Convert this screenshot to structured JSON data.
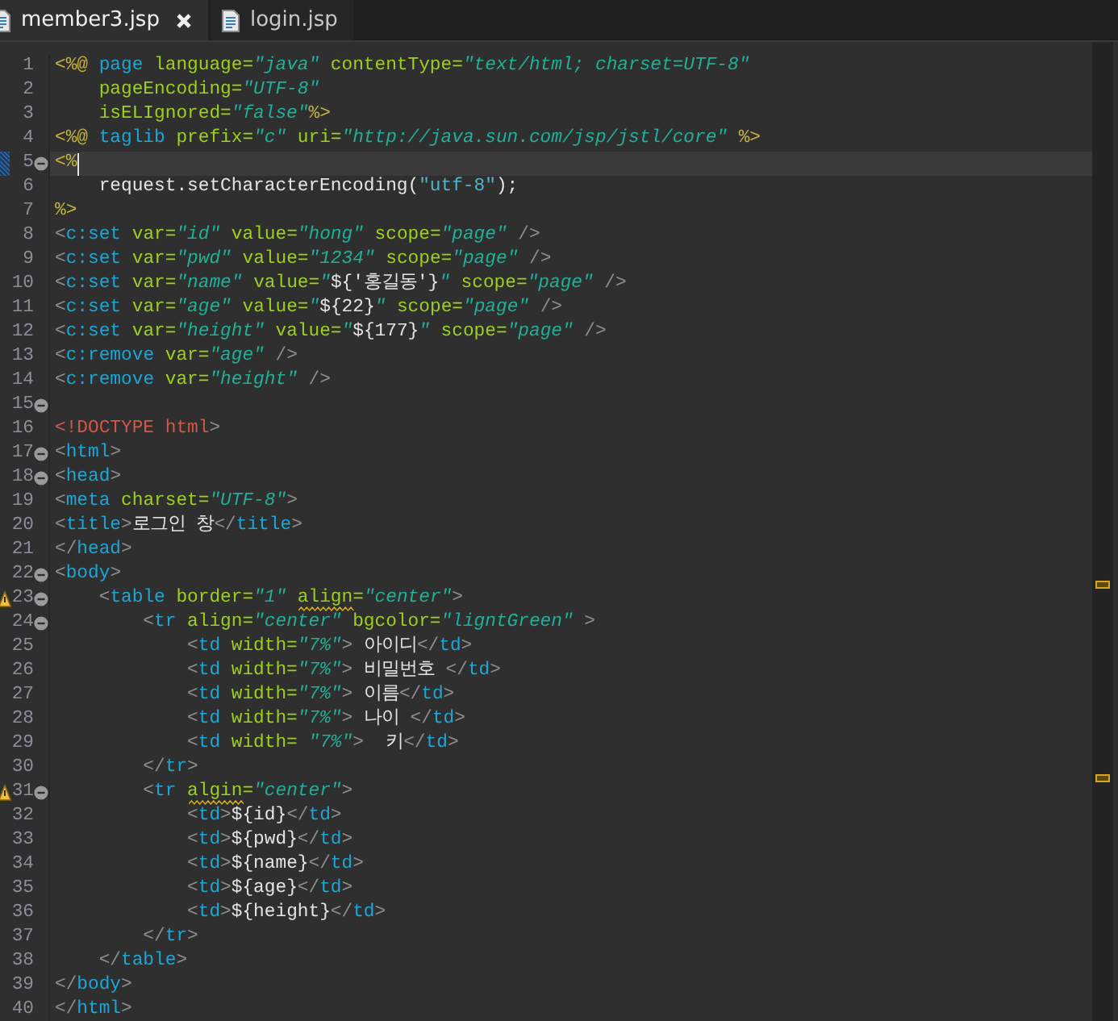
{
  "tabs": [
    {
      "label": "member3.jsp",
      "selected": true,
      "closable": true
    },
    {
      "label": "login.jsp",
      "selected": false,
      "closable": false
    }
  ],
  "lines": [
    {
      "number": "1",
      "tokens": [
        {
          "kind": "jsp",
          "text": "<%@ "
        },
        {
          "kind": "tag",
          "text": "page "
        },
        {
          "kind": "attr",
          "text": "language="
        },
        {
          "kind": "str",
          "text": "\"java\""
        },
        {
          "kind": "attr",
          "text": " contentType="
        },
        {
          "kind": "str",
          "text": "\"text/html; charset=UTF-8\""
        }
      ]
    },
    {
      "number": "2",
      "tokens": [
        {
          "kind": "attr",
          "text": "    pageEncoding="
        },
        {
          "kind": "str",
          "text": "\"UTF-8\""
        }
      ]
    },
    {
      "number": "3",
      "tokens": [
        {
          "kind": "attr",
          "text": "    isELIgnored="
        },
        {
          "kind": "str",
          "text": "\"false\""
        },
        {
          "kind": "jsp",
          "text": "%>"
        }
      ]
    },
    {
      "number": "4",
      "tokens": [
        {
          "kind": "jsp",
          "text": "<%@ "
        },
        {
          "kind": "tag",
          "text": "taglib "
        },
        {
          "kind": "attr",
          "text": "prefix="
        },
        {
          "kind": "str",
          "text": "\"c\""
        },
        {
          "kind": "attr",
          "text": " uri="
        },
        {
          "kind": "str",
          "text": "\"http://java.sun.com/jsp/jstl/core\""
        },
        {
          "kind": "jsp",
          "text": " %>"
        }
      ]
    },
    {
      "number": "5",
      "fold": true,
      "current": true,
      "changed": true,
      "tokens": [
        {
          "kind": "jsp",
          "text": "<%"
        }
      ]
    },
    {
      "number": "6",
      "tokens": [
        {
          "kind": "text",
          "text": "    request.setCharacterEncoding("
        },
        {
          "kind": "jstr",
          "text": "\"utf-8\""
        },
        {
          "kind": "text",
          "text": ");"
        }
      ]
    },
    {
      "number": "7",
      "tokens": [
        {
          "kind": "jsp",
          "text": "%>"
        }
      ]
    },
    {
      "number": "8",
      "tokens": [
        {
          "kind": "punct",
          "text": "<"
        },
        {
          "kind": "tag",
          "text": "c:set"
        },
        {
          "kind": "attr",
          "text": " var="
        },
        {
          "kind": "str",
          "text": "\"id\""
        },
        {
          "kind": "attr",
          "text": " value="
        },
        {
          "kind": "str",
          "text": "\"hong\""
        },
        {
          "kind": "attr",
          "text": " scope="
        },
        {
          "kind": "str",
          "text": "\"page\""
        },
        {
          "kind": "punct",
          "text": " />"
        }
      ]
    },
    {
      "number": "9",
      "tokens": [
        {
          "kind": "punct",
          "text": "<"
        },
        {
          "kind": "tag",
          "text": "c:set"
        },
        {
          "kind": "attr",
          "text": " var="
        },
        {
          "kind": "str",
          "text": "\"pwd\""
        },
        {
          "kind": "attr",
          "text": " value="
        },
        {
          "kind": "str",
          "text": "\"1234\""
        },
        {
          "kind": "attr",
          "text": " scope="
        },
        {
          "kind": "str",
          "text": "\"page\""
        },
        {
          "kind": "punct",
          "text": " />"
        }
      ]
    },
    {
      "number": "10",
      "tokens": [
        {
          "kind": "punct",
          "text": "<"
        },
        {
          "kind": "tag",
          "text": "c:set"
        },
        {
          "kind": "attr",
          "text": " var="
        },
        {
          "kind": "str",
          "text": "\"name\""
        },
        {
          "kind": "attr",
          "text": " value="
        },
        {
          "kind": "str",
          "text": "\""
        },
        {
          "kind": "text",
          "text": "${'홍길동'}"
        },
        {
          "kind": "str",
          "text": "\""
        },
        {
          "kind": "attr",
          "text": " scope="
        },
        {
          "kind": "str",
          "text": "\"page\""
        },
        {
          "kind": "punct",
          "text": " />"
        }
      ]
    },
    {
      "number": "11",
      "tokens": [
        {
          "kind": "punct",
          "text": "<"
        },
        {
          "kind": "tag",
          "text": "c:set"
        },
        {
          "kind": "attr",
          "text": " var="
        },
        {
          "kind": "str",
          "text": "\"age\""
        },
        {
          "kind": "attr",
          "text": " value="
        },
        {
          "kind": "str",
          "text": "\""
        },
        {
          "kind": "text",
          "text": "${22}"
        },
        {
          "kind": "str",
          "text": "\""
        },
        {
          "kind": "attr",
          "text": " scope="
        },
        {
          "kind": "str",
          "text": "\"page\""
        },
        {
          "kind": "punct",
          "text": " />"
        }
      ]
    },
    {
      "number": "12",
      "tokens": [
        {
          "kind": "punct",
          "text": "<"
        },
        {
          "kind": "tag",
          "text": "c:set"
        },
        {
          "kind": "attr",
          "text": " var="
        },
        {
          "kind": "str",
          "text": "\"height\""
        },
        {
          "kind": "attr",
          "text": " value="
        },
        {
          "kind": "str",
          "text": "\""
        },
        {
          "kind": "text",
          "text": "${177}"
        },
        {
          "kind": "str",
          "text": "\""
        },
        {
          "kind": "attr",
          "text": " scope="
        },
        {
          "kind": "str",
          "text": "\"page\""
        },
        {
          "kind": "punct",
          "text": " />"
        }
      ]
    },
    {
      "number": "13",
      "tokens": [
        {
          "kind": "punct",
          "text": "<"
        },
        {
          "kind": "tag",
          "text": "c:remove"
        },
        {
          "kind": "attr",
          "text": " var="
        },
        {
          "kind": "str",
          "text": "\"age\""
        },
        {
          "kind": "punct",
          "text": " />"
        }
      ]
    },
    {
      "number": "14",
      "tokens": [
        {
          "kind": "punct",
          "text": "<"
        },
        {
          "kind": "tag",
          "text": "c:remove"
        },
        {
          "kind": "attr",
          "text": " var="
        },
        {
          "kind": "str",
          "text": "\"height\""
        },
        {
          "kind": "punct",
          "text": " />"
        }
      ]
    },
    {
      "number": "15",
      "fold": true
    },
    {
      "number": "16",
      "tokens": [
        {
          "kind": "doctype",
          "text": "<!DOCTYPE html"
        },
        {
          "kind": "punct",
          "text": ">"
        }
      ]
    },
    {
      "number": "17",
      "fold": true,
      "tokens": [
        {
          "kind": "punct",
          "text": "<"
        },
        {
          "kind": "tag",
          "text": "html"
        },
        {
          "kind": "punct",
          "text": ">"
        }
      ]
    },
    {
      "number": "18",
      "fold": true,
      "tokens": [
        {
          "kind": "punct",
          "text": "<"
        },
        {
          "kind": "tag",
          "text": "head"
        },
        {
          "kind": "punct",
          "text": ">"
        }
      ]
    },
    {
      "number": "19",
      "tokens": [
        {
          "kind": "punct",
          "text": "<"
        },
        {
          "kind": "tag",
          "text": "meta"
        },
        {
          "kind": "attr",
          "text": " charset="
        },
        {
          "kind": "str",
          "text": "\"UTF-8\""
        },
        {
          "kind": "punct",
          "text": ">"
        }
      ]
    },
    {
      "number": "20",
      "tokens": [
        {
          "kind": "punct",
          "text": "<"
        },
        {
          "kind": "tag",
          "text": "title"
        },
        {
          "kind": "punct",
          "text": ">"
        },
        {
          "kind": "text",
          "text": "로그인 창"
        },
        {
          "kind": "punct",
          "text": "</"
        },
        {
          "kind": "tag",
          "text": "title"
        },
        {
          "kind": "punct",
          "text": ">"
        }
      ]
    },
    {
      "number": "21",
      "tokens": [
        {
          "kind": "punct",
          "text": "</"
        },
        {
          "kind": "tag",
          "text": "head"
        },
        {
          "kind": "punct",
          "text": ">"
        }
      ]
    },
    {
      "number": "22",
      "fold": true,
      "tokens": [
        {
          "kind": "punct",
          "text": "<"
        },
        {
          "kind": "tag",
          "text": "body"
        },
        {
          "kind": "punct",
          "text": ">"
        }
      ]
    },
    {
      "number": "23",
      "fold": true,
      "warning": true,
      "tokens": [
        {
          "kind": "punct",
          "text": "    <"
        },
        {
          "kind": "tag",
          "text": "table"
        },
        {
          "kind": "attr",
          "text": " border="
        },
        {
          "kind": "str",
          "text": "\"1\" "
        },
        {
          "kind": "attr",
          "text": "align",
          "warning": true
        },
        {
          "kind": "attr",
          "text": "="
        },
        {
          "kind": "str",
          "text": "\"center\""
        },
        {
          "kind": "punct",
          "text": ">"
        }
      ]
    },
    {
      "number": "24",
      "fold": true,
      "tokens": [
        {
          "kind": "punct",
          "text": "        <"
        },
        {
          "kind": "tag",
          "text": "tr"
        },
        {
          "kind": "attr",
          "text": " align="
        },
        {
          "kind": "str",
          "text": "\"center\""
        },
        {
          "kind": "attr",
          "text": " bgcolor="
        },
        {
          "kind": "str",
          "text": "\"ligntGreen\""
        },
        {
          "kind": "punct",
          "text": " >"
        }
      ]
    },
    {
      "number": "25",
      "tokens": [
        {
          "kind": "punct",
          "text": "            <"
        },
        {
          "kind": "tag",
          "text": "td"
        },
        {
          "kind": "attr",
          "text": " width="
        },
        {
          "kind": "str",
          "text": "\"7%\""
        },
        {
          "kind": "punct",
          "text": ">"
        },
        {
          "kind": "text",
          "text": " 아이디"
        },
        {
          "kind": "punct",
          "text": "</"
        },
        {
          "kind": "tag",
          "text": "td"
        },
        {
          "kind": "punct",
          "text": ">"
        }
      ]
    },
    {
      "number": "26",
      "tokens": [
        {
          "kind": "punct",
          "text": "            <"
        },
        {
          "kind": "tag",
          "text": "td"
        },
        {
          "kind": "attr",
          "text": " width="
        },
        {
          "kind": "str",
          "text": "\"7%\""
        },
        {
          "kind": "punct",
          "text": ">"
        },
        {
          "kind": "text",
          "text": " 비밀번호 "
        },
        {
          "kind": "punct",
          "text": "</"
        },
        {
          "kind": "tag",
          "text": "td"
        },
        {
          "kind": "punct",
          "text": ">"
        }
      ]
    },
    {
      "number": "27",
      "tokens": [
        {
          "kind": "punct",
          "text": "            <"
        },
        {
          "kind": "tag",
          "text": "td"
        },
        {
          "kind": "attr",
          "text": " width="
        },
        {
          "kind": "str",
          "text": "\"7%\""
        },
        {
          "kind": "punct",
          "text": ">"
        },
        {
          "kind": "text",
          "text": " 이름"
        },
        {
          "kind": "punct",
          "text": "</"
        },
        {
          "kind": "tag",
          "text": "td"
        },
        {
          "kind": "punct",
          "text": ">"
        }
      ]
    },
    {
      "number": "28",
      "tokens": [
        {
          "kind": "punct",
          "text": "            <"
        },
        {
          "kind": "tag",
          "text": "td"
        },
        {
          "kind": "attr",
          "text": " width="
        },
        {
          "kind": "str",
          "text": "\"7%\""
        },
        {
          "kind": "punct",
          "text": ">"
        },
        {
          "kind": "text",
          "text": " 나이 "
        },
        {
          "kind": "punct",
          "text": "</"
        },
        {
          "kind": "tag",
          "text": "td"
        },
        {
          "kind": "punct",
          "text": ">"
        }
      ]
    },
    {
      "number": "29",
      "tokens": [
        {
          "kind": "punct",
          "text": "            <"
        },
        {
          "kind": "tag",
          "text": "td"
        },
        {
          "kind": "attr",
          "text": " width= "
        },
        {
          "kind": "str",
          "text": "\"7%\""
        },
        {
          "kind": "punct",
          "text": ">"
        },
        {
          "kind": "text",
          "text": "  키"
        },
        {
          "kind": "punct",
          "text": "</"
        },
        {
          "kind": "tag",
          "text": "td"
        },
        {
          "kind": "punct",
          "text": ">"
        }
      ]
    },
    {
      "number": "30",
      "tokens": [
        {
          "kind": "punct",
          "text": "        </"
        },
        {
          "kind": "tag",
          "text": "tr"
        },
        {
          "kind": "punct",
          "text": ">"
        }
      ]
    },
    {
      "number": "31",
      "fold": true,
      "warning": true,
      "tokens": [
        {
          "kind": "punct",
          "text": "        <"
        },
        {
          "kind": "tag",
          "text": "tr "
        },
        {
          "kind": "attr",
          "text": "algin",
          "warning": true
        },
        {
          "kind": "attr",
          "text": "="
        },
        {
          "kind": "str",
          "text": "\"center\""
        },
        {
          "kind": "punct",
          "text": ">"
        }
      ]
    },
    {
      "number": "32",
      "tokens": [
        {
          "kind": "punct",
          "text": "            <"
        },
        {
          "kind": "tag",
          "text": "td"
        },
        {
          "kind": "punct",
          "text": ">"
        },
        {
          "kind": "text",
          "text": "${id}"
        },
        {
          "kind": "punct",
          "text": "</"
        },
        {
          "kind": "tag",
          "text": "td"
        },
        {
          "kind": "punct",
          "text": ">"
        }
      ]
    },
    {
      "number": "33",
      "tokens": [
        {
          "kind": "punct",
          "text": "            <"
        },
        {
          "kind": "tag",
          "text": "td"
        },
        {
          "kind": "punct",
          "text": ">"
        },
        {
          "kind": "text",
          "text": "${pwd}"
        },
        {
          "kind": "punct",
          "text": "</"
        },
        {
          "kind": "tag",
          "text": "td"
        },
        {
          "kind": "punct",
          "text": ">"
        }
      ]
    },
    {
      "number": "34",
      "tokens": [
        {
          "kind": "punct",
          "text": "            <"
        },
        {
          "kind": "tag",
          "text": "td"
        },
        {
          "kind": "punct",
          "text": ">"
        },
        {
          "kind": "text",
          "text": "${name}"
        },
        {
          "kind": "punct",
          "text": "</"
        },
        {
          "kind": "tag",
          "text": "td"
        },
        {
          "kind": "punct",
          "text": ">"
        }
      ]
    },
    {
      "number": "35",
      "tokens": [
        {
          "kind": "punct",
          "text": "            <"
        },
        {
          "kind": "tag",
          "text": "td"
        },
        {
          "kind": "punct",
          "text": ">"
        },
        {
          "kind": "text",
          "text": "${age}"
        },
        {
          "kind": "punct",
          "text": "</"
        },
        {
          "kind": "tag",
          "text": "td"
        },
        {
          "kind": "punct",
          "text": ">"
        }
      ]
    },
    {
      "number": "36",
      "tokens": [
        {
          "kind": "punct",
          "text": "            <"
        },
        {
          "kind": "tag",
          "text": "td"
        },
        {
          "kind": "punct",
          "text": ">"
        },
        {
          "kind": "text",
          "text": "${height}"
        },
        {
          "kind": "punct",
          "text": "</"
        },
        {
          "kind": "tag",
          "text": "td"
        },
        {
          "kind": "punct",
          "text": ">"
        }
      ]
    },
    {
      "number": "37",
      "tokens": [
        {
          "kind": "punct",
          "text": "        </"
        },
        {
          "kind": "tag",
          "text": "tr"
        },
        {
          "kind": "punct",
          "text": ">"
        }
      ]
    },
    {
      "number": "38",
      "tokens": [
        {
          "kind": "punct",
          "text": "    </"
        },
        {
          "kind": "tag",
          "text": "table"
        },
        {
          "kind": "punct",
          "text": ">"
        }
      ]
    },
    {
      "number": "39",
      "tokens": [
        {
          "kind": "punct",
          "text": "</"
        },
        {
          "kind": "tag",
          "text": "body"
        },
        {
          "kind": "punct",
          "text": ">"
        }
      ]
    },
    {
      "number": "40",
      "tokens": [
        {
          "kind": "punct",
          "text": "</"
        },
        {
          "kind": "tag",
          "text": "html"
        },
        {
          "kind": "punct",
          "text": ">"
        }
      ]
    }
  ]
}
